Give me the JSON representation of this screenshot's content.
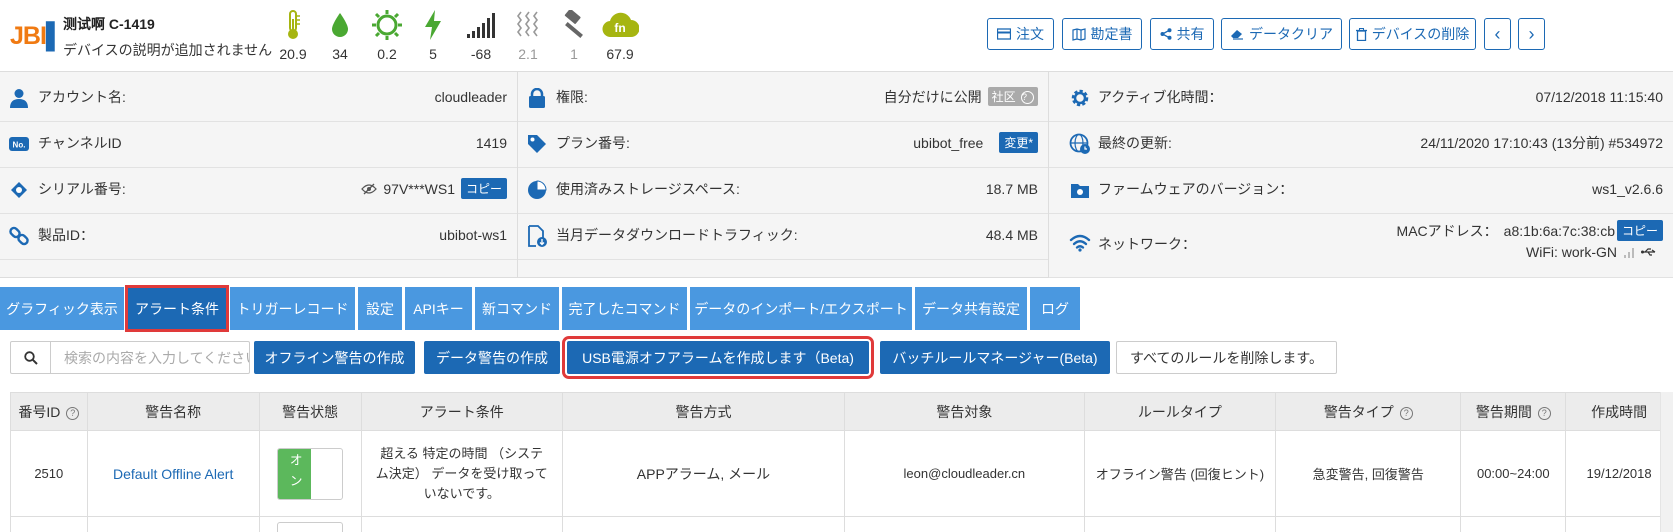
{
  "device": {
    "logo_text": "JBI",
    "title": "测试啊 C-1419",
    "description": "デバイスの説明が追加されません"
  },
  "sensors": [
    {
      "icon": "thermometer-icon",
      "value": "20.9"
    },
    {
      "icon": "humidity-drop-icon",
      "value": "34"
    },
    {
      "icon": "light-sun-icon",
      "value": "0.2"
    },
    {
      "icon": "voltage-bolt-icon",
      "value": "5"
    },
    {
      "icon": "signal-bars-icon",
      "value": "-68"
    },
    {
      "icon": "vibration-icon",
      "value": "2.1"
    },
    {
      "icon": "knock-hammer-icon",
      "value": "1"
    },
    {
      "icon": "fn-cloud-icon",
      "value": "67.9"
    }
  ],
  "header_buttons": {
    "order": "注文",
    "invoice": "勘定書",
    "share": "共有",
    "clear_data": "データクリア",
    "delete_device": "デバイスの削除",
    "prev": "‹",
    "next": "›"
  },
  "info": {
    "account_label": "アカウント名:",
    "account_value": "cloudleader",
    "channel_label": "チャンネルID",
    "channel_value": "1419",
    "serial_label": "シリアル番号:",
    "serial_value": "97V***WS1",
    "serial_copy": "コピー",
    "product_label": "製品ID：",
    "product_value": "ubibot-ws1",
    "permission_label": "権限:",
    "permission_value": "自分だけに公開",
    "permission_badge": "社区",
    "plan_label": "プラン番号:",
    "plan_value": "ubibot_free",
    "plan_change": "変更*",
    "storage_label": "使用済みストレージスペース:",
    "storage_value": "18.7 MB",
    "traffic_label": "当月データダウンロードトラフィック:",
    "traffic_value": "48.4 MB",
    "activation_label": "アクティブ化時間：",
    "activation_value": "07/12/2018 11:15:40",
    "last_update_label": "最終の更新:",
    "last_update_value": "24/11/2020 17:10:43 (13分前) #534972",
    "firmware_label": "ファームウェアのバージョン：",
    "firmware_value": "ws1_v2.6.6",
    "network_label": "ネットワーク：",
    "mac_label": "MACアドレス：",
    "mac_value": "a8:1b:6a:7c:38:cb",
    "mac_copy": "コピー",
    "wifi_value": "WiFi: work-GN"
  },
  "tabs": [
    "グラフィック表示",
    "アラート条件",
    "トリガーレコード",
    "設定",
    "APIキー",
    "新コマンド",
    "完了したコマンド",
    "データのインポート/エクスポート",
    "データ共有設定",
    "ログ"
  ],
  "toolbar": {
    "search_placeholder": "検索の内容を入力してください",
    "offline_alert": "オフライン警告の作成",
    "data_alert": "データ警告の作成",
    "usb_alarm": "USB電源オフアラームを作成します（Beta)",
    "batch_rules": "バッチルールマネージャー(Beta)",
    "delete_all": "すべてのルールを削除します。"
  },
  "table": {
    "headers": {
      "id": "番号ID",
      "name": "警告名称",
      "status": "警告状態",
      "condition": "アラート条件",
      "method": "警告方式",
      "target": "警告対象",
      "rule_type": "ルールタイプ",
      "alert_type": "警告タイプ",
      "period": "警告期間",
      "created": "作成時間"
    },
    "rows": [
      {
        "id": "2510",
        "name": "Default Offline Alert",
        "status": "オン",
        "condition": "超える 特定の時間 （システム決定） データを受け取っていないです。",
        "method": "APPアラーム, メール",
        "target": "leon@cloudleader.cn",
        "rule_type": "オフライン警告 (回復ヒント)",
        "alert_type": "急変警告, 回復警告",
        "period": "00:00~24:00",
        "created": "19/12/2018"
      }
    ]
  },
  "colors": {
    "primary": "#1c69b4",
    "tab": "#4a98e0",
    "highlight": "#e03a3a",
    "toggle_on": "#5cb85c",
    "brand_orange": "#f07a12",
    "sensor_yellow_green": "#a6b511",
    "sensor_green": "#4aa832"
  }
}
